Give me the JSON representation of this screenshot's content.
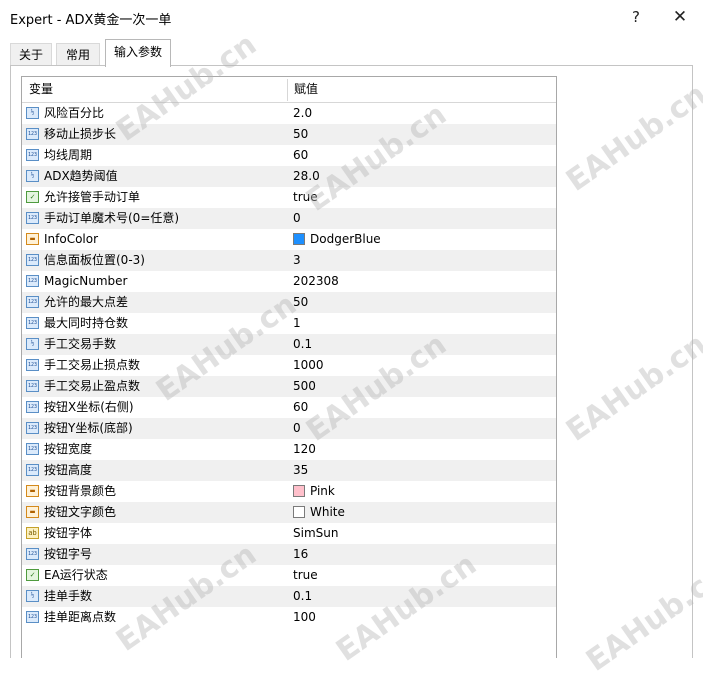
{
  "window": {
    "title": "Expert - ADX黄金一次一单",
    "help_label": "?",
    "close_label": "✕"
  },
  "tabs": [
    {
      "label": "关于",
      "active": false
    },
    {
      "label": "常用",
      "active": false
    },
    {
      "label": "输入参数",
      "active": true
    }
  ],
  "grid": {
    "columns": {
      "variable": "变量",
      "value": "赋值"
    },
    "rows": [
      {
        "icon": "double-icon",
        "name": "风险百分比",
        "value": "2.0"
      },
      {
        "icon": "int-icon",
        "name": "移动止损步长",
        "value": "50"
      },
      {
        "icon": "int-icon",
        "name": "均线周期",
        "value": "60"
      },
      {
        "icon": "double-icon",
        "name": "ADX趋势阈值",
        "value": "28.0"
      },
      {
        "icon": "bool-icon",
        "name": "允许接管手动订单",
        "value": "true"
      },
      {
        "icon": "int-icon",
        "name": "手动订单魔术号(0=任意)",
        "value": "0"
      },
      {
        "icon": "color-icon",
        "name": "InfoColor",
        "value": "DodgerBlue",
        "swatch": "#1E90FF"
      },
      {
        "icon": "int-icon",
        "name": "信息面板位置(0-3)",
        "value": "3"
      },
      {
        "icon": "int-icon",
        "name": "MagicNumber",
        "value": "202308"
      },
      {
        "icon": "int-icon",
        "name": "允许的最大点差",
        "value": "50"
      },
      {
        "icon": "int-icon",
        "name": "最大同时持仓数",
        "value": "1"
      },
      {
        "icon": "double-icon",
        "name": "手工交易手数",
        "value": "0.1"
      },
      {
        "icon": "int-icon",
        "name": "手工交易止损点数",
        "value": "1000"
      },
      {
        "icon": "int-icon",
        "name": "手工交易止盈点数",
        "value": "500"
      },
      {
        "icon": "int-icon",
        "name": "按钮X坐标(右侧)",
        "value": "60"
      },
      {
        "icon": "int-icon",
        "name": "按钮Y坐标(底部)",
        "value": "0"
      },
      {
        "icon": "int-icon",
        "name": "按钮宽度",
        "value": "120"
      },
      {
        "icon": "int-icon",
        "name": "按钮高度",
        "value": "35"
      },
      {
        "icon": "color-icon",
        "name": "按钮背景颜色",
        "value": "Pink",
        "swatch": "#FFC0CB"
      },
      {
        "icon": "color-icon",
        "name": "按钮文字颜色",
        "value": "White",
        "swatch": "#FFFFFF"
      },
      {
        "icon": "string-icon",
        "name": "按钮字体",
        "value": "SimSun"
      },
      {
        "icon": "int-icon",
        "name": "按钮字号",
        "value": "16"
      },
      {
        "icon": "bool-icon",
        "name": "EA运行状态",
        "value": "true"
      },
      {
        "icon": "double-icon",
        "name": "挂单手数",
        "value": "0.1"
      },
      {
        "icon": "int-icon",
        "name": "挂单距离点数",
        "value": "100"
      }
    ]
  },
  "watermark": "EAHub.cn"
}
